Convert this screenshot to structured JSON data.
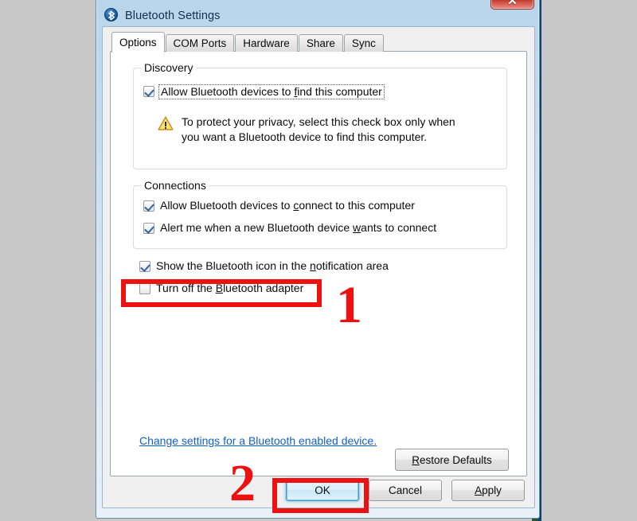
{
  "window": {
    "title": "Bluetooth Settings",
    "icon": "bluetooth-icon",
    "close_label": "✕"
  },
  "tabs": [
    {
      "label": "Options",
      "active": true
    },
    {
      "label": "COM Ports",
      "active": false
    },
    {
      "label": "Hardware",
      "active": false
    },
    {
      "label": "Share",
      "active": false
    },
    {
      "label": "Sync",
      "active": false
    }
  ],
  "discovery": {
    "group_title": "Discovery",
    "checkbox": {
      "label_before": "Allow Bluetooth devices to ",
      "label_mnemonic": "f",
      "label_after": "ind this computer",
      "checked": true,
      "focused": true
    },
    "warning": {
      "icon": "warning-triangle-icon",
      "text": "To protect your privacy, select this check box only when\nyou want a Bluetooth device to find this computer."
    }
  },
  "connections": {
    "group_title": "Connections",
    "checkboxes": [
      {
        "label_before": "Allow Bluetooth devices to ",
        "label_mnemonic": "c",
        "label_after": "onnect to this computer",
        "checked": true
      },
      {
        "label_before": "Alert me when a new Bluetooth device ",
        "label_mnemonic": "w",
        "label_after": "ants to connect",
        "checked": true
      }
    ]
  },
  "standalone_checkboxes": [
    {
      "label_before": "Show the Bluetooth icon in the ",
      "label_mnemonic": "n",
      "label_after": "otification area",
      "checked": true
    },
    {
      "label_before": "Turn off the ",
      "label_mnemonic": "B",
      "label_after": "luetooth adapter",
      "checked": false
    }
  ],
  "link": {
    "text": "Change settings for a Bluetooth enabled device."
  },
  "restore_defaults": {
    "label_before": "",
    "label_mnemonic": "R",
    "label_after": "estore Defaults"
  },
  "footer": {
    "ok_label": "OK",
    "cancel_label": "Cancel",
    "apply_before": "",
    "apply_mnemonic": "A",
    "apply_after": "pply"
  },
  "annotations": [
    {
      "number": "1",
      "target": "turn-off-bluetooth-adapter-checkbox"
    },
    {
      "number": "2",
      "target": "ok-button"
    }
  ],
  "colors": {
    "annotation_red": "#ee1111",
    "link_blue": "#1061c4",
    "check_blue": "#2d62a8",
    "warning_yellow": "#f5c431",
    "titlebar_blue": "#b9d4ea"
  }
}
